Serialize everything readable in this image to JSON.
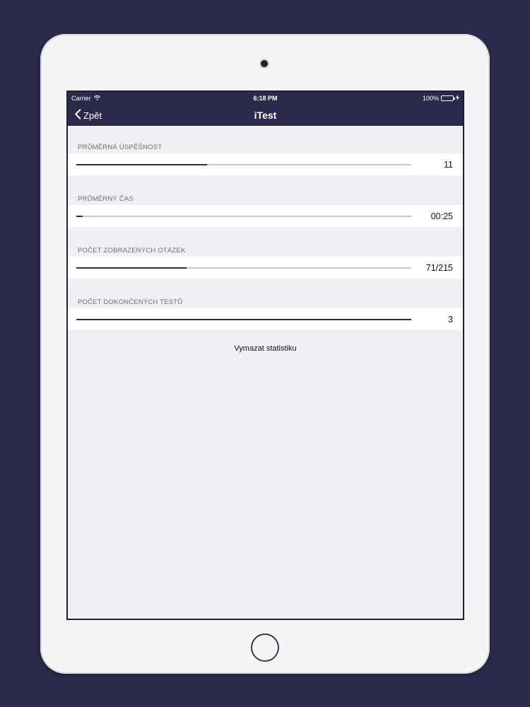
{
  "status_bar": {
    "carrier": "Carrier",
    "time": "6:18 PM",
    "battery": "100%"
  },
  "navbar": {
    "back_label": "Zpět",
    "title": "iTest"
  },
  "stats": [
    {
      "label": "PRŮMĚRNÁ ÚSPĚŠNOST",
      "value": "11",
      "progress": 0.39
    },
    {
      "label": "PRŮMĚRNÝ ČAS",
      "value": "00:25",
      "progress": 0.02
    },
    {
      "label": "POČET ZOBRAZENÝCH OTÁZEK",
      "value": "71/215",
      "progress": 0.33
    },
    {
      "label": "POČET DOKONČENÝCH TESTŮ",
      "value": "3",
      "progress": 1.0
    }
  ],
  "clear_label": "Vymazat statistiku",
  "colors": {
    "accent": "#2a2b4b",
    "battery": "#4cd964"
  }
}
